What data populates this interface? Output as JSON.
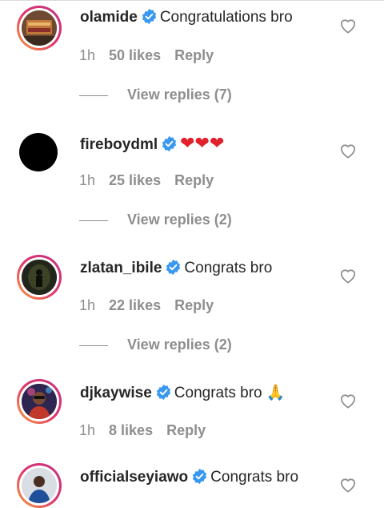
{
  "comments": [
    {
      "username": "olamide",
      "text": "Congratulations bro",
      "time": "1h",
      "likes": "50 likes",
      "reply": "Reply",
      "view_replies": "View replies (7)",
      "avatar": "avatar-olamide"
    },
    {
      "username": "fireboydml",
      "text": "❤❤❤",
      "time": "1h",
      "likes": "25 likes",
      "reply": "Reply",
      "view_replies": "View replies (2)",
      "avatar": "avatar-fireboydml"
    },
    {
      "username": "zlatan_ibile",
      "text": "Congrats bro",
      "time": "1h",
      "likes": "22 likes",
      "reply": "Reply",
      "view_replies": "View replies (2)",
      "avatar": "avatar-zlatan"
    },
    {
      "username": "djkaywise",
      "text": "Congrats bro 🙏",
      "time": "1h",
      "likes": "8 likes",
      "reply": "Reply",
      "avatar": "avatar-djkaywise"
    },
    {
      "username": "officialseyiawo",
      "text": "Congrats bro",
      "avatar": "avatar-seyiawo"
    }
  ],
  "icons": {
    "verified": "verified-badge-icon",
    "like": "heart-outline-icon"
  },
  "colors": {
    "verified_blue": "#3897f0",
    "secondary_text": "#8e8e8e",
    "primary_text": "#262626",
    "story_ring_start": "#f9a13a",
    "story_ring_end": "#c13584"
  }
}
